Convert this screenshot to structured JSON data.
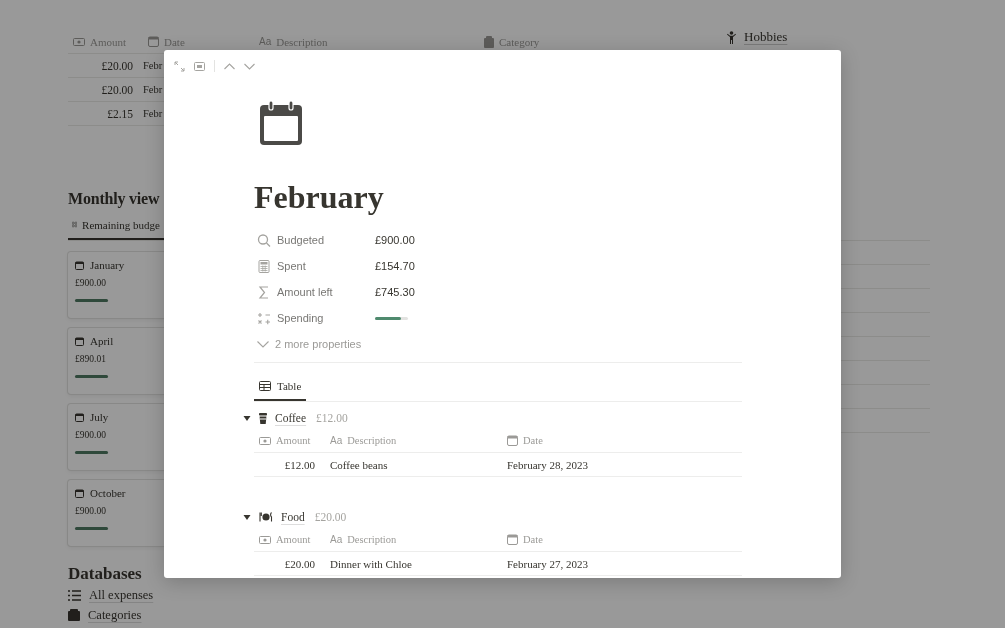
{
  "background": {
    "expenses_table": {
      "columns": [
        {
          "kind": "money",
          "label": "Amount"
        },
        {
          "kind": "date",
          "label": "Date"
        },
        {
          "kind": "text",
          "icon": "Aa",
          "label": "Description"
        },
        {
          "kind": "category",
          "label": "Category"
        }
      ],
      "rows": [
        {
          "amount": "£20.00",
          "date": "Febr"
        },
        {
          "amount": "£20.00",
          "date": "Febr"
        },
        {
          "amount": "£2.15",
          "date": "Febr"
        }
      ]
    },
    "hobbies_link": "Hobbies",
    "monthly_views": {
      "heading": "Monthly view",
      "tabs": [
        {
          "label": "Remaining budge",
          "selected": true
        }
      ],
      "cards": [
        {
          "title": "January",
          "amount": "£900.00",
          "level": 1
        },
        {
          "title": "April",
          "amount": "£890.01",
          "level": 0.99
        },
        {
          "title": "July",
          "amount": "£900.00",
          "level": 1
        },
        {
          "title": "October",
          "amount": "£900.00",
          "level": 1
        }
      ]
    },
    "databases": {
      "heading": "Databases",
      "items": [
        {
          "kind": "list",
          "label": "All expenses"
        },
        {
          "kind": "category",
          "label": "Categories"
        }
      ]
    }
  },
  "peek": {
    "title": "February",
    "properties": [
      {
        "kind": "search",
        "label": "Budgeted",
        "value": "£900.00"
      },
      {
        "kind": "calculator",
        "label": "Spent",
        "value": "£154.70"
      },
      {
        "kind": "sum",
        "label": "Amount left",
        "value": "£745.30"
      },
      {
        "kind": "formula",
        "label": "Spending",
        "level": 0.8
      }
    ],
    "more_properties": "2 more properties",
    "tabs": [
      {
        "label": "Table",
        "selected": true
      }
    ],
    "groups": [
      {
        "kind": "cup",
        "name": "Coffee",
        "total": "£12.00",
        "expanded": true,
        "columns": [
          {
            "kind": "money",
            "label": "Amount"
          },
          {
            "kind": "text",
            "icon": "Aa",
            "label": "Description"
          },
          {
            "kind": "date",
            "label": "Date"
          }
        ],
        "rows": [
          {
            "amount": "£12.00",
            "description": "Coffee beans",
            "date": "February 28, 2023"
          }
        ]
      },
      {
        "kind": "food",
        "name": "Food",
        "total": "£20.00",
        "expanded": true,
        "columns": [
          {
            "kind": "money",
            "label": "Amount"
          },
          {
            "kind": "text",
            "icon": "Aa",
            "label": "Description"
          },
          {
            "kind": "date",
            "label": "Date"
          }
        ],
        "rows": [
          {
            "amount": "£20.00",
            "description": "Dinner with Chloe",
            "date": "February 27, 2023"
          }
        ]
      }
    ]
  }
}
